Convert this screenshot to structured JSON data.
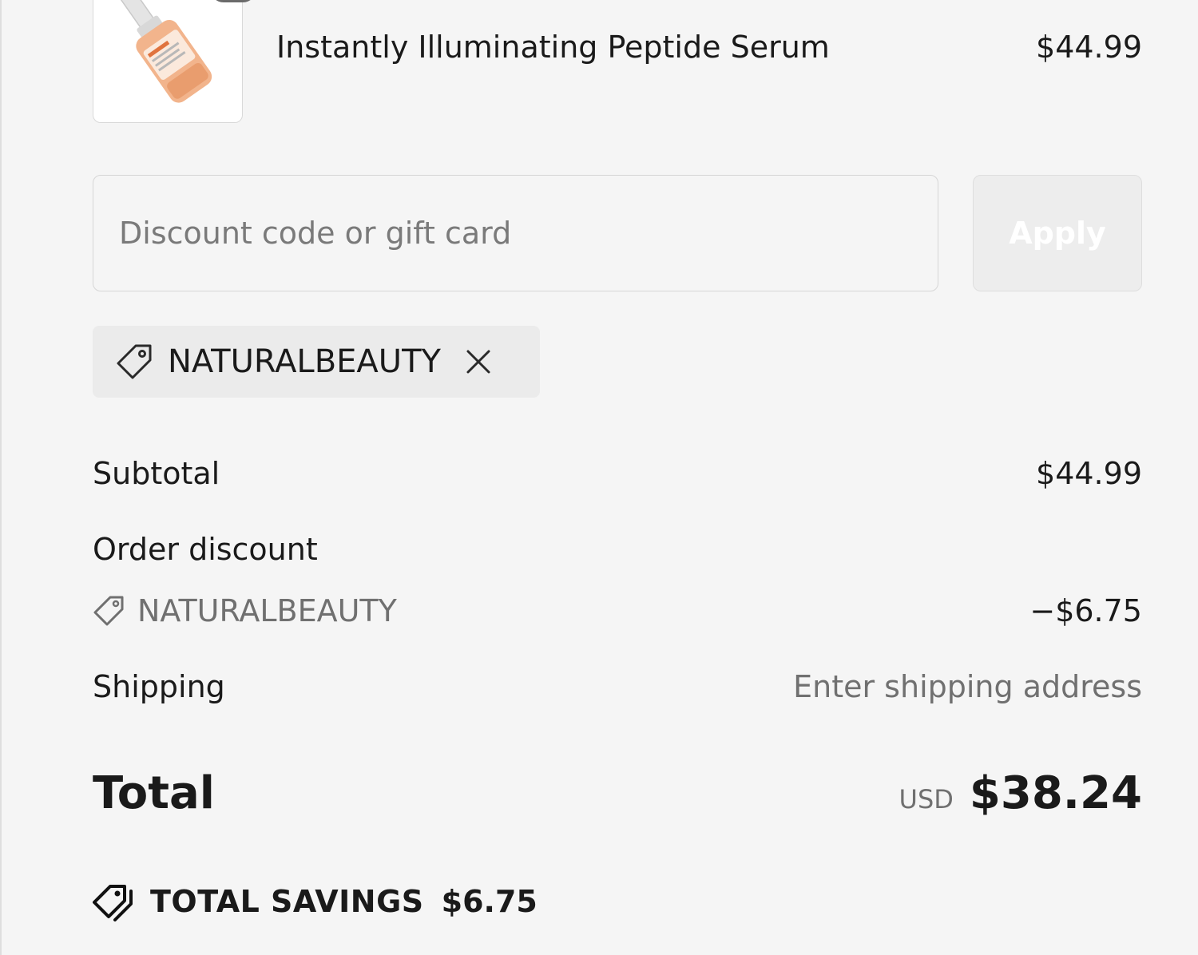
{
  "product": {
    "name": "Instantly Illuminating Peptide Serum",
    "price": "$44.99"
  },
  "discount_form": {
    "placeholder": "Discount code or gift card",
    "value": "",
    "apply_label": "Apply"
  },
  "applied_code": {
    "code": "NATURALBEAUTY"
  },
  "summary": {
    "subtotal_label": "Subtotal",
    "subtotal_value": "$44.99",
    "order_discount_label": "Order discount",
    "discount_code": "NATURALBEAUTY",
    "discount_value": "−$6.75",
    "shipping_label": "Shipping",
    "shipping_value": "Enter shipping address",
    "total_label": "Total",
    "currency": "USD",
    "total_value": "$38.24",
    "savings_label": "TOTAL SAVINGS",
    "savings_value": "$6.75"
  },
  "icons": {
    "tag": "tag-icon",
    "close": "close-icon",
    "tags": "tags-icon"
  },
  "colors": {
    "background": "#f5f5f5",
    "text": "#1a1a1a",
    "muted_text": "#707070",
    "chip_background": "#ebebeb",
    "button_background": "#ededed",
    "button_text": "#ffffff",
    "product_accent": "#f0a070"
  }
}
